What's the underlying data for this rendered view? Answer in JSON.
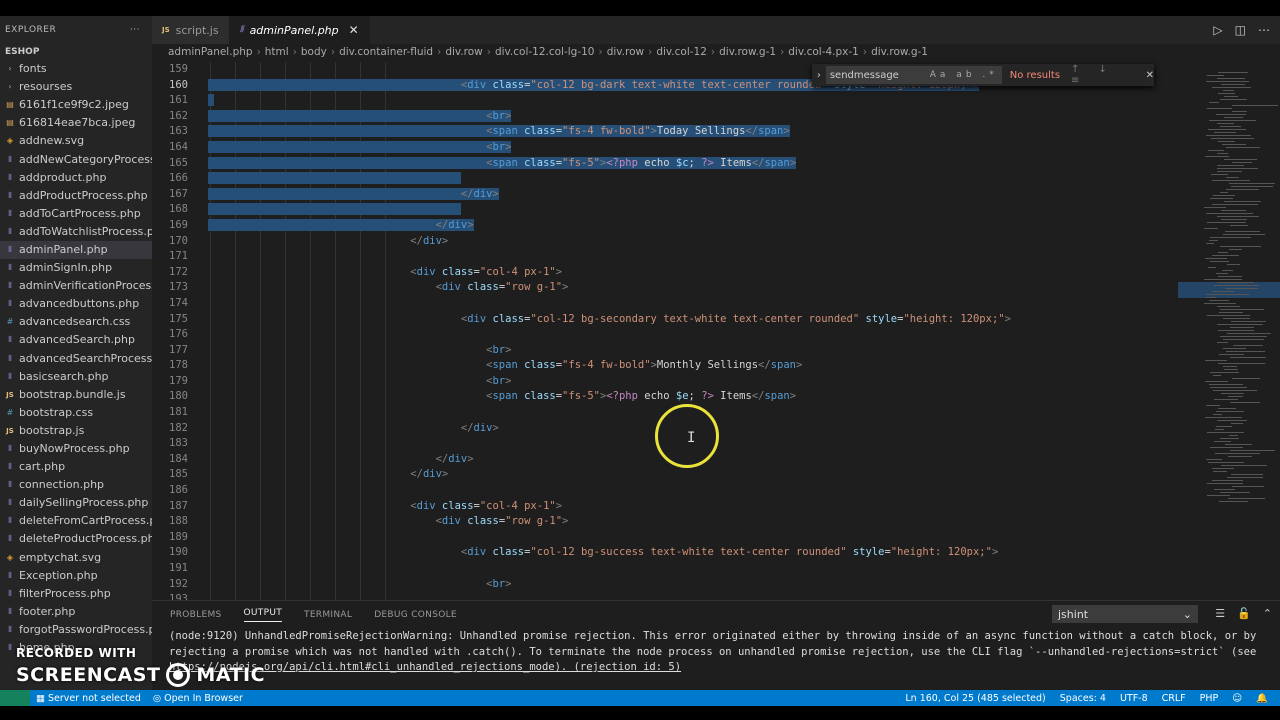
{
  "explorer": {
    "title": "EXPLORER",
    "menu_glyph": "···",
    "project": "ESHOP",
    "files": [
      {
        "name": "fonts",
        "icon": "folder-chevron-icon",
        "glyph": "›"
      },
      {
        "name": "resourses",
        "icon": "folder-chevron-icon",
        "glyph": "›"
      },
      {
        "name": "6161f1ce9f9c2.jpeg",
        "icon": "image-file-icon",
        "glyph": "▤"
      },
      {
        "name": "616814eae7bca.jpeg",
        "icon": "image-file-icon",
        "glyph": "▤"
      },
      {
        "name": "addnew.svg",
        "icon": "svg-file-icon",
        "glyph": "◈"
      },
      {
        "name": "addNewCategoryProcess.p...",
        "icon": "php-file-icon",
        "glyph": "⦀"
      },
      {
        "name": "addproduct.php",
        "icon": "php-file-icon",
        "glyph": "⦀"
      },
      {
        "name": "addProductProcess.php",
        "icon": "php-file-icon",
        "glyph": "⦀"
      },
      {
        "name": "addToCartProcess.php",
        "icon": "php-file-icon",
        "glyph": "⦀"
      },
      {
        "name": "addToWatchlistProcess.php",
        "icon": "php-file-icon",
        "glyph": "⦀"
      },
      {
        "name": "adminPanel.php",
        "icon": "php-file-icon",
        "glyph": "⦀",
        "active": true
      },
      {
        "name": "adminSignIn.php",
        "icon": "php-file-icon",
        "glyph": "⦀"
      },
      {
        "name": "adminVerificationProcess.p...",
        "icon": "php-file-icon",
        "glyph": "⦀"
      },
      {
        "name": "advancedbuttons.php",
        "icon": "php-file-icon",
        "glyph": "⦀"
      },
      {
        "name": "advancedsearch.css",
        "icon": "css-file-icon",
        "glyph": "#"
      },
      {
        "name": "advancedSearch.php",
        "icon": "php-file-icon",
        "glyph": "⦀"
      },
      {
        "name": "advancedSearchProcess.php",
        "icon": "php-file-icon",
        "glyph": "⦀"
      },
      {
        "name": "basicsearch.php",
        "icon": "php-file-icon",
        "glyph": "⦀"
      },
      {
        "name": "bootstrap.bundle.js",
        "icon": "js-file-icon",
        "glyph": "JS"
      },
      {
        "name": "bootstrap.css",
        "icon": "css-file-icon",
        "glyph": "#"
      },
      {
        "name": "bootstrap.js",
        "icon": "js-file-icon",
        "glyph": "JS"
      },
      {
        "name": "buyNowProcess.php",
        "icon": "php-file-icon",
        "glyph": "⦀"
      },
      {
        "name": "cart.php",
        "icon": "php-file-icon",
        "glyph": "⦀"
      },
      {
        "name": "connection.php",
        "icon": "php-file-icon",
        "glyph": "⦀"
      },
      {
        "name": "dailySellingProcess.php",
        "icon": "php-file-icon",
        "glyph": "⦀"
      },
      {
        "name": "deleteFromCartProcess.php",
        "icon": "php-file-icon",
        "glyph": "⦀"
      },
      {
        "name": "deleteProductProcess.php",
        "icon": "php-file-icon",
        "glyph": "⦀"
      },
      {
        "name": "emptychat.svg",
        "icon": "svg-file-icon",
        "glyph": "◈"
      },
      {
        "name": "Exception.php",
        "icon": "php-file-icon",
        "glyph": "⦀"
      },
      {
        "name": "filterProcess.php",
        "icon": "php-file-icon",
        "glyph": "⦀"
      },
      {
        "name": "footer.php",
        "icon": "php-file-icon",
        "glyph": "⦀"
      },
      {
        "name": "forgotPasswordProcess.php",
        "icon": "php-file-icon",
        "glyph": "⦀"
      },
      {
        "name": "home.php",
        "icon": "php-file-icon",
        "glyph": "⦀"
      }
    ]
  },
  "tabs": [
    {
      "label": "script.js",
      "glyph": "JS",
      "active": false
    },
    {
      "label": "adminPanel.php",
      "glyph": "⦀",
      "active": true,
      "close": "✕"
    }
  ],
  "breadcrumb": [
    "adminPanel.php",
    "html",
    "body",
    "div.container-fluid",
    "div.row",
    "div.col-12.col-lg-10",
    "div.row",
    "div.col-12",
    "div.row.g-1",
    "div.col-4.px-1",
    "div.row.g-1"
  ],
  "find": {
    "value": "sendmessage",
    "options": "Aa ab .*",
    "result": "No results",
    "buttons": "↑ ↓ ≡",
    "close": "✕"
  },
  "editor": {
    "line_numbers": [
      "159",
      "160",
      "161",
      "162",
      "163",
      "164",
      "165",
      "166",
      "167",
      "168",
      "169",
      "170",
      "171",
      "172",
      "173",
      "174",
      "175",
      "176",
      "177",
      "178",
      "179",
      "180",
      "181",
      "182",
      "183",
      "184",
      "185",
      "186",
      "187",
      "188",
      "189",
      "190",
      "191",
      "192",
      "193"
    ],
    "current_line": "160"
  },
  "panel": {
    "tabs": [
      "PROBLEMS",
      "OUTPUT",
      "TERMINAL",
      "DEBUG CONSOLE"
    ],
    "active_tab": "OUTPUT",
    "channel": "jshint",
    "output_lines": [
      "(node:9120) UnhandledPromiseRejectionWarning: Unhandled promise rejection. This error originated either by throwing inside of an async function without a catch block, or by",
      "rejecting a promise which was not handled with .catch(). To terminate the node process on unhandled promise rejection, use the CLI flag `--unhandled-rejections=strict` (see",
      "https://nodejs.org/api/cli.html#cli_unhandled_rejections_mode). (rejection id: 5)"
    ]
  },
  "status": {
    "server": "Server not selected",
    "open_browser": "Open In Browser",
    "position": "Ln 160, Col 25 (485 selected)",
    "spaces": "Spaces: 4",
    "encoding": "UTF-8",
    "eol": "CRLF",
    "language": "PHP"
  },
  "watermark": {
    "line1": "RECORDED WITH",
    "line2a": "SCREENCAST",
    "line2b": "MATIC"
  },
  "colors": {
    "status_bar": "#007acc",
    "selection": "#264f78",
    "cursor_highlight": "#e8e23a"
  }
}
